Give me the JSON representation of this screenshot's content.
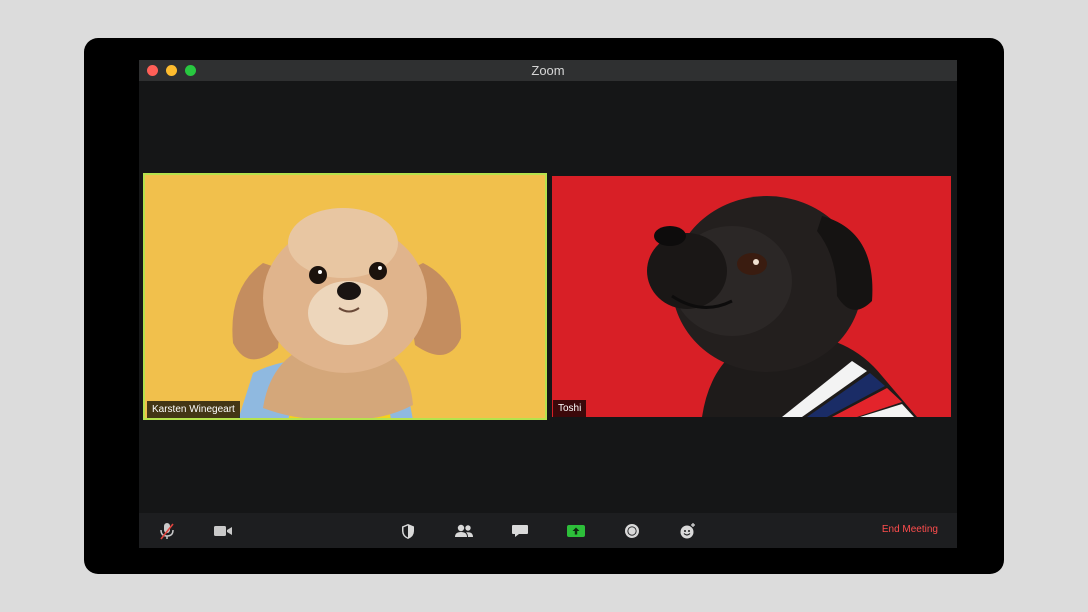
{
  "window": {
    "title": "Zoom",
    "traffic_lights": [
      "close",
      "minimize",
      "zoom"
    ]
  },
  "participants": [
    {
      "name": "Karsten Winegeart",
      "active_speaker": true,
      "background_color": "#f2c14e"
    },
    {
      "name": "Toshi",
      "active_speaker": false,
      "background_color": "#d91f24"
    }
  ],
  "toolbar": {
    "buttons": [
      {
        "id": "mute",
        "icon": "microphone-muted-icon"
      },
      {
        "id": "video",
        "icon": "video-camera-icon"
      },
      {
        "id": "security",
        "icon": "shield-icon"
      },
      {
        "id": "participants",
        "icon": "participants-icon"
      },
      {
        "id": "chat",
        "icon": "chat-bubble-icon"
      },
      {
        "id": "share",
        "icon": "share-screen-icon",
        "color": "#2dbf3a"
      },
      {
        "id": "record",
        "icon": "record-icon"
      },
      {
        "id": "reactions",
        "icon": "reactions-icon"
      }
    ],
    "end_meeting_label": "End Meeting",
    "end_meeting_color": "#ff4d4d"
  }
}
